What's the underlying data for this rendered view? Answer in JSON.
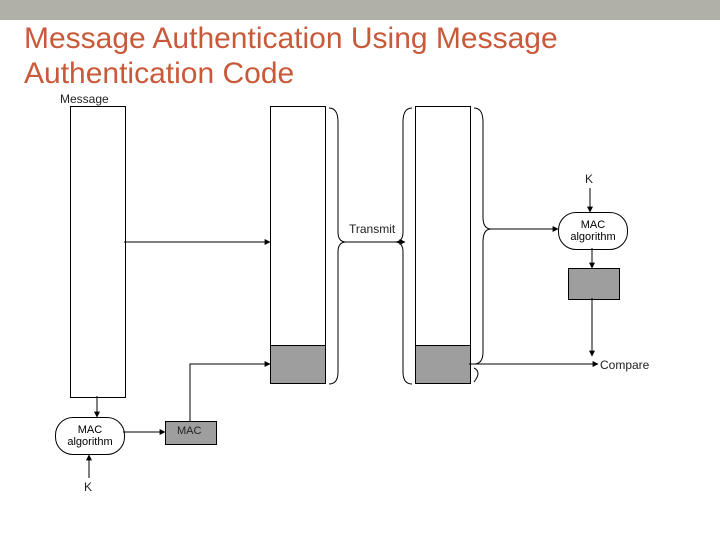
{
  "title": "Message Authentication Using Message Authentication Code",
  "labels": {
    "message": "Message",
    "mac": "MAC",
    "k_sender": "K",
    "k_receiver": "K",
    "transmit": "Transmit",
    "compare": "Compare",
    "mac_algo_sender": "MAC\nalgorithm",
    "mac_algo_receiver": "MAC\nalgorithm"
  }
}
